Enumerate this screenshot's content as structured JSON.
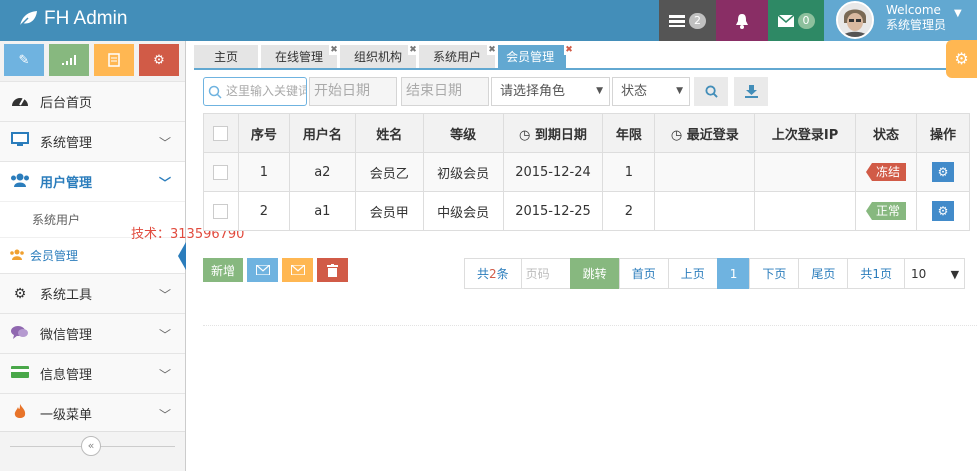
{
  "header": {
    "brand": "FH Admin",
    "tasks_count": "2",
    "mail_count": "0",
    "welcome": "Welcome",
    "username": "系统管理员",
    "colors": {
      "bar": "#438eb9",
      "tasks": "#555555",
      "alerts": "#892e65",
      "mail": "#2e8965",
      "user": "#62a8d1"
    }
  },
  "sidebar": {
    "shortcuts": [
      {
        "icon": "pencil-icon",
        "color": "#6fb3e0"
      },
      {
        "icon": "signal-icon",
        "color": "#87b87f"
      },
      {
        "icon": "book-icon",
        "color": "#ffb752"
      },
      {
        "icon": "cogs-icon",
        "color": "#d15b47"
      }
    ],
    "items": [
      {
        "label": "后台首页",
        "icon": "dashboard-icon"
      },
      {
        "label": "系统管理",
        "icon": "desktop-icon"
      },
      {
        "label": "用户管理",
        "icon": "users-icon"
      },
      {
        "label": "系统工具",
        "icon": "cog-icon"
      },
      {
        "label": "微信管理",
        "icon": "comments-icon"
      },
      {
        "label": "信息管理",
        "icon": "credit-card-icon"
      },
      {
        "label": "一级菜单",
        "icon": "fire-icon"
      }
    ],
    "subitems": [
      {
        "label": "系统用户"
      },
      {
        "label": "会员管理"
      }
    ]
  },
  "watermark": "技术：313596790",
  "tabs": [
    {
      "label": "主页"
    },
    {
      "label": "在线管理"
    },
    {
      "label": "组织机构"
    },
    {
      "label": "系统用户"
    },
    {
      "label": "会员管理",
      "active": true
    }
  ],
  "filters": {
    "keyword_placeholder": "这里输入关键词",
    "start_placeholder": "开始日期",
    "end_placeholder": "结束日期",
    "role": "请选择角色",
    "status": "状态"
  },
  "table": {
    "headers": [
      "序号",
      "用户名",
      "姓名",
      "等级",
      "到期日期",
      "年限",
      "最近登录",
      "上次登录IP",
      "状态",
      "操作"
    ],
    "rows": [
      {
        "no": "1",
        "username": "a2",
        "name": "会员乙",
        "level": "初级会员",
        "expire": "2015-12-24",
        "years": "1",
        "last_login": "",
        "last_ip": "",
        "status": "冻结",
        "status_color": "#d15b47"
      },
      {
        "no": "2",
        "username": "a1",
        "name": "会员甲",
        "level": "中级会员",
        "expire": "2015-12-25",
        "years": "2",
        "last_login": "",
        "last_ip": "",
        "status": "正常",
        "status_color": "#87b87f"
      }
    ]
  },
  "actions": {
    "add": "新增"
  },
  "pager": {
    "total_pre": "共",
    "total_num": "2",
    "total_post": "条",
    "page_placeholder": "页码",
    "go": "跳转",
    "first": "首页",
    "prev": "上页",
    "current": "1",
    "next": "下页",
    "last": "尾页",
    "pages": "共1页",
    "page_size": "10"
  }
}
